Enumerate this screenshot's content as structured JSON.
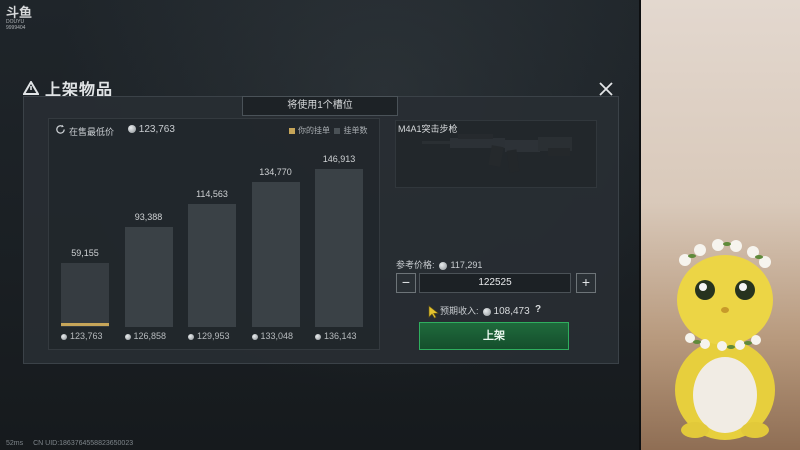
{
  "watermark": {
    "logo": "斗鱼",
    "sub": "DOUYU",
    "room": "9999404"
  },
  "dialog": {
    "title": "上架物品",
    "slot_notice": "将使用1个槽位"
  },
  "chart": {
    "lowest_label": "在售最低价",
    "lowest_value": "123,763",
    "legend_mine": "你的挂单",
    "legend_count": "挂单数",
    "colors": {
      "mine": "#c6a559",
      "bar": "#3a4146"
    }
  },
  "chart_data": {
    "type": "bar",
    "categories": [
      "123,763",
      "126,858",
      "129,953",
      "133,048",
      "136,143"
    ],
    "values": [
      59155,
      93388,
      114563,
      134770,
      146913
    ],
    "value_labels": [
      "59,155",
      "93,388",
      "114,563",
      "134,770",
      "146,913"
    ],
    "mine_index": 0
  },
  "item": {
    "name": "M4A1突击步枪"
  },
  "pricing": {
    "ref_label": "参考价格:",
    "ref_value": "117,291",
    "quantity": "122525",
    "minus": "−",
    "plus": "+",
    "income_label": "预期收入:",
    "income_value": "108,473",
    "help": "?",
    "list_button": "上架"
  },
  "status_bar": {
    "ping": "52ms",
    "uid": "CN UID:1863764558823650023"
  },
  "icons": {
    "refresh": "refresh-icon",
    "close": "close-icon",
    "coin": "coin-icon",
    "warning": "warning-triangle-icon"
  }
}
